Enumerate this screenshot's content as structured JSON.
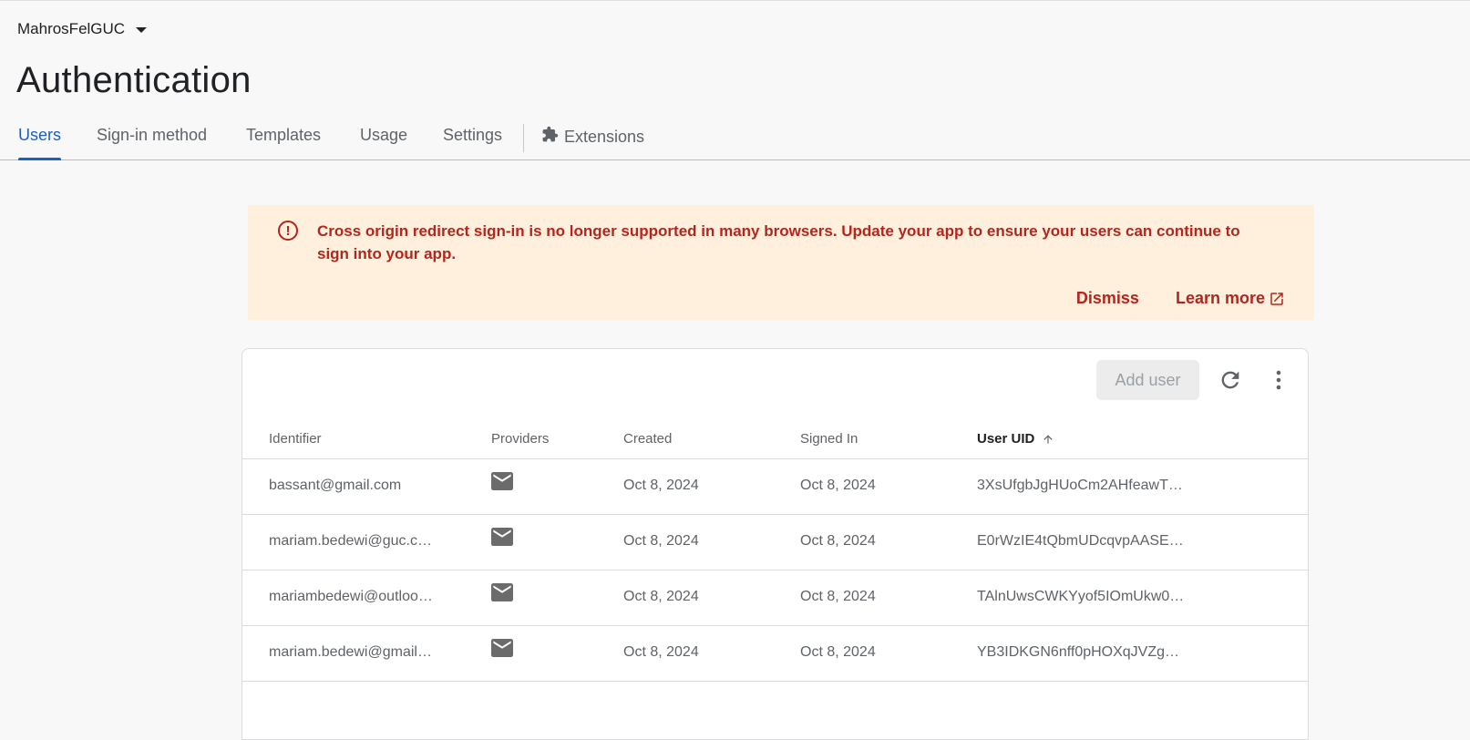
{
  "project": {
    "name": "MahrosFelGUC"
  },
  "page": {
    "title": "Authentication"
  },
  "tabs": [
    {
      "label": "Users"
    },
    {
      "label": "Sign-in method"
    },
    {
      "label": "Templates"
    },
    {
      "label": "Usage"
    },
    {
      "label": "Settings"
    },
    {
      "label": "Extensions",
      "icon": "extensions-icon"
    }
  ],
  "banner": {
    "message": "Cross origin redirect sign-in is no longer supported in many browsers. Update your app to ensure your users can continue to sign into your app.",
    "dismiss": "Dismiss",
    "learn_more": "Learn more",
    "color": "#b3261e",
    "background": "#fef0dc"
  },
  "users_table": {
    "add_user": "Add user",
    "columns": [
      "Identifier",
      "Providers",
      "Created",
      "Signed In",
      "User UID"
    ],
    "rows": [
      {
        "identifier": "bassant@gmail.com",
        "provider": "email-icon",
        "created": "Oct 8, 2024",
        "signed_in": "Oct 8, 2024",
        "uid": "3XsUfgbJgHUoCm2AHfeawTJ…"
      },
      {
        "identifier": "mariam.bedewi@guc.c…",
        "provider": "email-icon",
        "created": "Oct 8, 2024",
        "signed_in": "Oct 8, 2024",
        "uid": "E0rWzIE4tQbmUDcqvpAASEc…"
      },
      {
        "identifier": "mariambedewi@outloo…",
        "provider": "email-icon",
        "created": "Oct 8, 2024",
        "signed_in": "Oct 8, 2024",
        "uid": "TAlnUwsCWKYyof5IOmUkw09…"
      },
      {
        "identifier": "mariam.bedewi@gmail.…",
        "provider": "email-icon",
        "created": "Oct 8, 2024",
        "signed_in": "Oct 8, 2024",
        "uid": "YB3IDKGN6nff0pHOXqJVZgK…"
      }
    ]
  },
  "colors": {
    "accent": "#1a5fc4",
    "text": "#202124",
    "muted": "#5f6368"
  }
}
